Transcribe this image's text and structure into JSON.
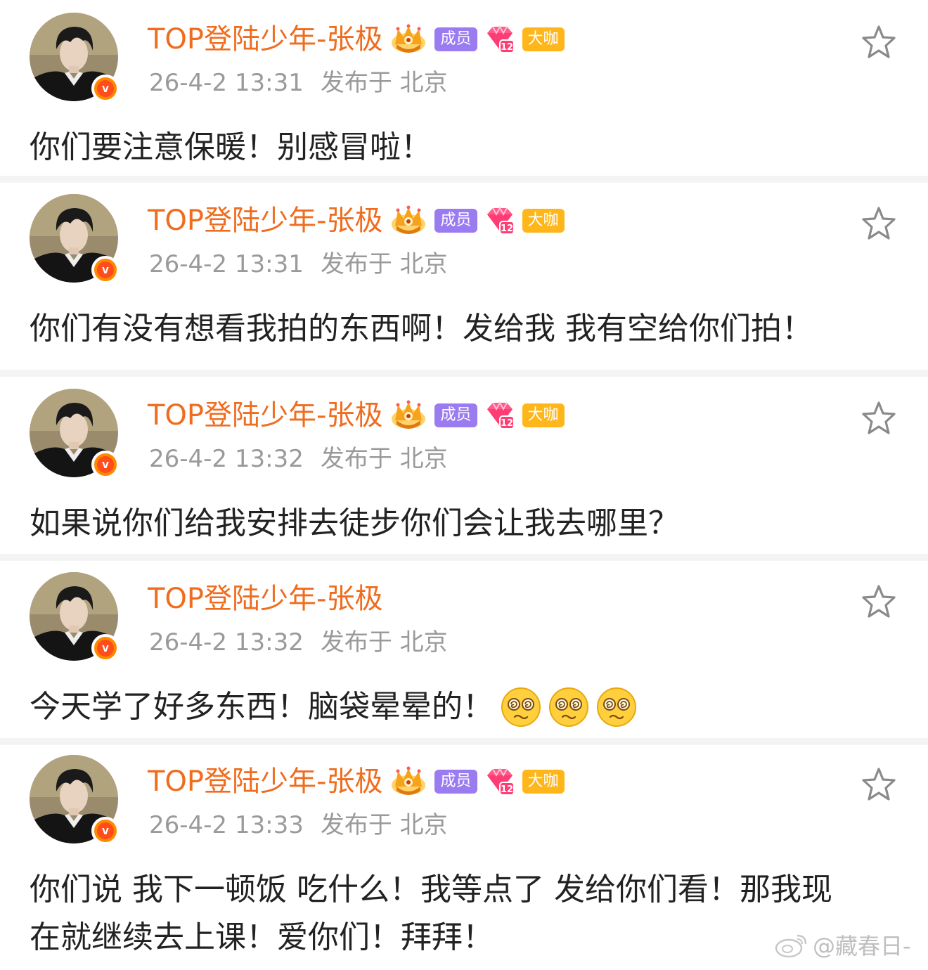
{
  "posts": [
    {
      "username": "TOP登陆少年-张极",
      "tags": {
        "member": "成员",
        "bigshot": "大咖",
        "level": "12"
      },
      "time": "26-4-2 13:31",
      "location": "发布于 北京",
      "text": "你们要注意保暖！别感冒啦！"
    },
    {
      "username": "TOP登陆少年-张极",
      "tags": {
        "member": "成员",
        "bigshot": "大咖",
        "level": "12"
      },
      "time": "26-4-2 13:31",
      "location": "发布于 北京",
      "text": "你们有没有想看我拍的东西啊！发给我 我有空给你们拍！"
    },
    {
      "username": "TOP登陆少年-张极",
      "tags": {
        "member": "成员",
        "bigshot": "大咖",
        "level": "12"
      },
      "time": "26-4-2 13:32",
      "location": "发布于 北京",
      "text": "如果说你们给我安排去徒步你们会让我去哪里？"
    },
    {
      "username": "TOP登陆少年-张极",
      "time": "26-4-2 13:32",
      "location": "发布于 北京",
      "text": "今天学了好多东西！脑袋晕晕的！",
      "emojis": [
        "dizzy-face-emoji",
        "dizzy-face-emoji",
        "dizzy-face-emoji"
      ]
    },
    {
      "username": "TOP登陆少年-张极",
      "tags": {
        "member": "成员",
        "bigshot": "大咖",
        "level": "12"
      },
      "time": "26-4-2 13:33",
      "location": "发布于 北京",
      "text_line1": "你们说 我下一顿饭 吃什么！我等点了 发给你们看！那我现",
      "text_line2": "在就继续去上课！爱你们！拜拜！"
    }
  ],
  "watermark": "@藏春日-",
  "colors": {
    "username": "#f06c1e",
    "meta": "#9a9a9a",
    "member_tag": "#9b7bf0",
    "bigshot_tag": "#ffb61a",
    "verified": "#ff8a00"
  }
}
